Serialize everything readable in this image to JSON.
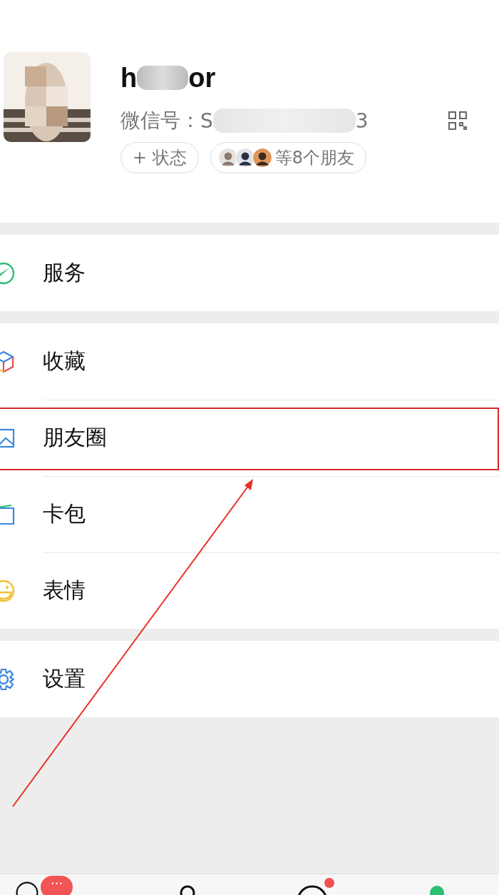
{
  "profile": {
    "name_start": "h",
    "name_end": "or",
    "id_label": "微信号：",
    "id_start": "S",
    "id_end": "3",
    "status_button": "+ 状态",
    "friends_text": "等8个朋友"
  },
  "groups": [
    {
      "items": [
        {
          "label": "服务",
          "highlighted": false
        }
      ]
    },
    {
      "items": [
        {
          "label": "收藏",
          "highlighted": false
        },
        {
          "label": "朋友圈",
          "highlighted": true
        },
        {
          "label": "卡包",
          "highlighted": false
        },
        {
          "label": "表情",
          "highlighted": false
        }
      ]
    },
    {
      "items": [
        {
          "label": "设置",
          "highlighted": false
        }
      ]
    }
  ],
  "annotation_arrow": true,
  "tab_bar": {
    "tabs": [
      {
        "selected": false,
        "badge": "···",
        "dot": false
      },
      {
        "selected": false,
        "dot": false
      },
      {
        "selected": false,
        "dot": true
      },
      {
        "selected": true,
        "dot": false
      }
    ]
  }
}
